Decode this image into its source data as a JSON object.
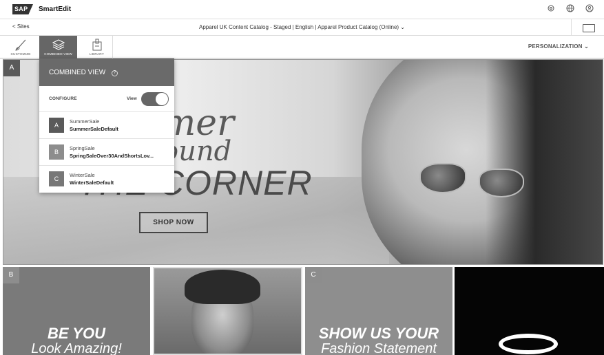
{
  "topbar": {
    "logo": "SAP",
    "app_name": "SmartEdit",
    "icons": [
      "settings-icon",
      "globe-icon",
      "user-icon"
    ]
  },
  "subbar": {
    "back_label": "< Sites",
    "catalog_label": "Apparel UK Content Catalog - Staged | English | Apparel Product Catalog (Online) ⌄"
  },
  "toolbar": {
    "customize_label": "CUSTOMIZE",
    "combined_label": "COMBINED VIEW",
    "library_label": "LIBRARY",
    "personalization_label": "PERSONALIZATION ⌄"
  },
  "banner": {
    "marker": "A",
    "slogan_line1": "mer",
    "slogan_line2": "ound",
    "slogan_line3": "THE CORNER",
    "shop_now": "SHOP NOW"
  },
  "tiles": {
    "tile1_marker": "B",
    "tile1_line1": "BE YOU",
    "tile1_line2": "Look Amazing!",
    "tile3_marker": "C",
    "tile3_line1": "SHOW US YOUR",
    "tile3_line2": "Fashion Statement"
  },
  "popup": {
    "title": "COMBINED VIEW",
    "help": "?",
    "configure_label": "CONFIGURE",
    "view_label": "View",
    "toggle_on": true,
    "experiences": [
      {
        "marker": "A",
        "name": "SummerSale",
        "variation": "SummerSaleDefault"
      },
      {
        "marker": "B",
        "name": "SpringSale",
        "variation": "SpringSaleOver30AndShortsLov..."
      },
      {
        "marker": "C",
        "name": "WinterSale",
        "variation": "WinterSaleDefault"
      }
    ]
  }
}
